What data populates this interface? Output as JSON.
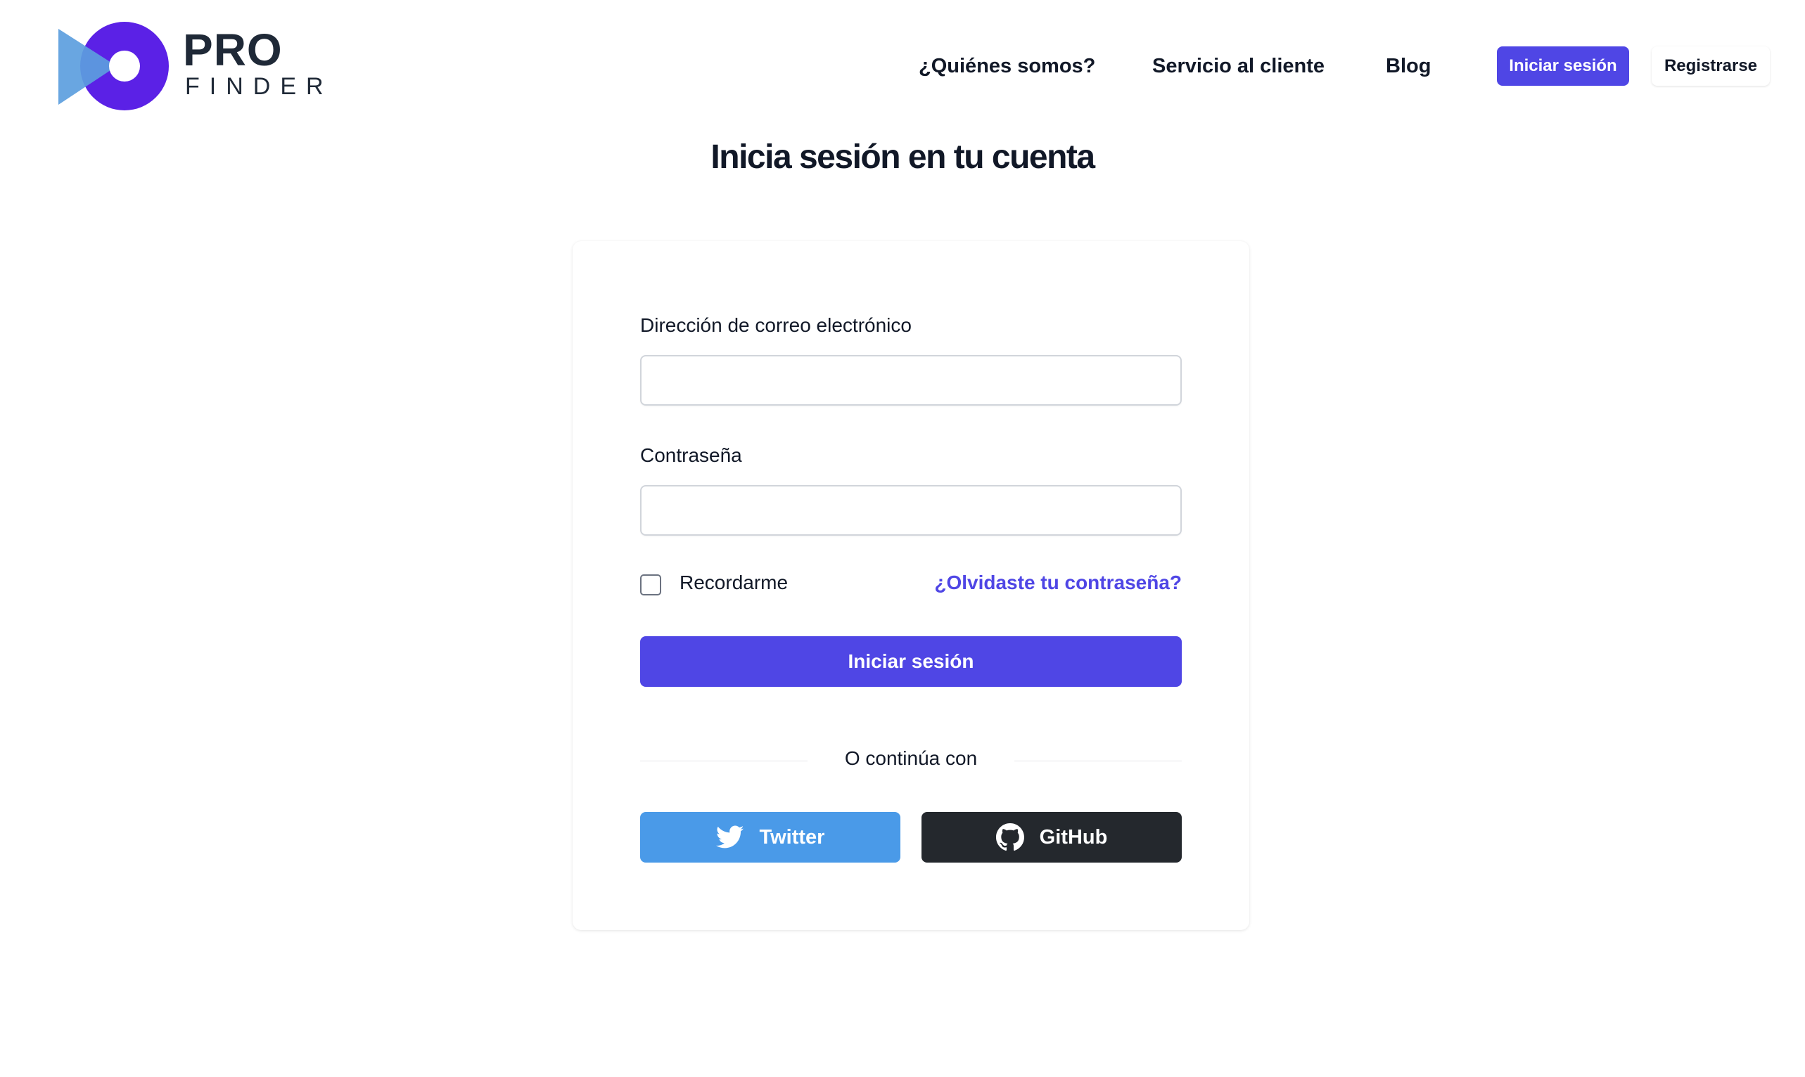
{
  "brand": {
    "name_top": "PRO",
    "name_bottom": "FINDER"
  },
  "nav": {
    "links": [
      "¿Quiénes somos?",
      "Servicio al cliente",
      "Blog"
    ],
    "login_label": "Iniciar sesión",
    "register_label": "Registrarse"
  },
  "page": {
    "title": "Inicia sesión en tu cuenta"
  },
  "form": {
    "email_label": "Dirección de correo electrónico",
    "email_value": "",
    "password_label": "Contraseña",
    "password_value": "",
    "remember_label": "Recordarme",
    "remember_checked": false,
    "forgot_label": "¿Olvidaste tu contraseña?",
    "submit_label": "Iniciar sesión"
  },
  "social": {
    "divider_text": "O continúa con",
    "twitter_label": "Twitter",
    "github_label": "GitHub"
  },
  "colors": {
    "accent": "#4f46e5",
    "twitter": "#4a9ae8",
    "github": "#24282d",
    "text": "#111827"
  },
  "icons": [
    "logo-mark-icon",
    "twitter-bird-icon",
    "github-octocat-icon"
  ]
}
